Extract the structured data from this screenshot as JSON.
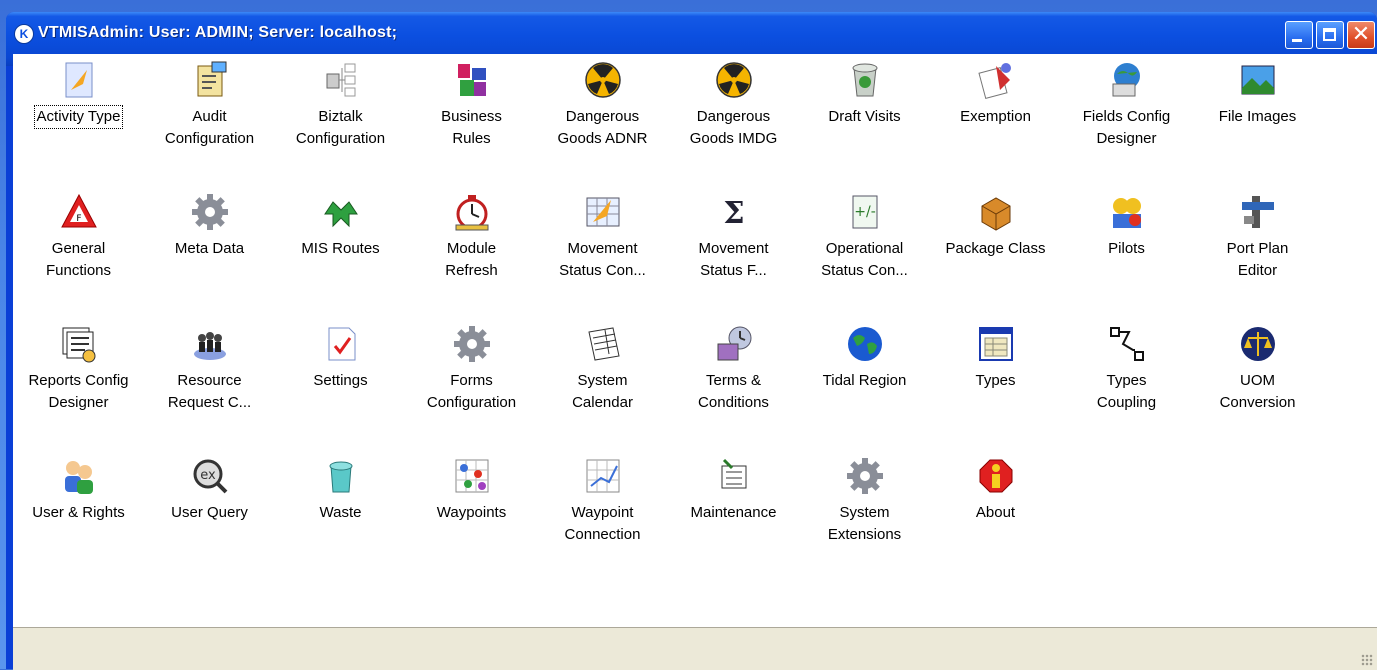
{
  "window": {
    "title": "VTMISAdmin: User: ADMIN; Server: localhost;",
    "app_icon_glyph": "K"
  },
  "items": [
    {
      "label": "Activity Type",
      "icon": "activity-type-icon"
    },
    {
      "label": "Audit\nConfiguration",
      "icon": "audit-configuration-icon"
    },
    {
      "label": "Biztalk\nConfiguration",
      "icon": "biztalk-configuration-icon"
    },
    {
      "label": "Business\nRules",
      "icon": "business-rules-icon"
    },
    {
      "label": "Dangerous\nGoods ADNR",
      "icon": "dangerous-goods-adnr-icon"
    },
    {
      "label": "Dangerous\nGoods IMDG",
      "icon": "dangerous-goods-imdg-icon"
    },
    {
      "label": "Draft Visits",
      "icon": "draft-visits-icon"
    },
    {
      "label": "Exemption",
      "icon": "exemption-icon"
    },
    {
      "label": "Fields Config\nDesigner",
      "icon": "fields-config-designer-icon"
    },
    {
      "label": "File Images",
      "icon": "file-images-icon"
    },
    {
      "label": "General\nFunctions",
      "icon": "general-functions-icon"
    },
    {
      "label": "Meta Data",
      "icon": "meta-data-icon"
    },
    {
      "label": "MIS Routes",
      "icon": "mis-routes-icon"
    },
    {
      "label": "Module\nRefresh",
      "icon": "module-refresh-icon"
    },
    {
      "label": "Movement\nStatus Con...",
      "icon": "movement-status-con-icon"
    },
    {
      "label": "Movement\nStatus F...",
      "icon": "movement-status-f-icon"
    },
    {
      "label": "Operational\nStatus Con...",
      "icon": "operational-status-con-icon"
    },
    {
      "label": "Package Class",
      "icon": "package-class-icon"
    },
    {
      "label": "Pilots",
      "icon": "pilots-icon"
    },
    {
      "label": "Port Plan\nEditor",
      "icon": "port-plan-editor-icon"
    },
    {
      "label": "Reports Config\nDesigner",
      "icon": "reports-config-designer-icon"
    },
    {
      "label": "Resource\nRequest C...",
      "icon": "resource-request-icon"
    },
    {
      "label": "Settings",
      "icon": "settings-icon"
    },
    {
      "label": "Forms\nConfiguration",
      "icon": "forms-configuration-icon"
    },
    {
      "label": "System\nCalendar",
      "icon": "system-calendar-icon"
    },
    {
      "label": "Terms &\nConditions",
      "icon": "terms-conditions-icon"
    },
    {
      "label": "Tidal Region",
      "icon": "tidal-region-icon"
    },
    {
      "label": "Types",
      "icon": "types-icon"
    },
    {
      "label": "Types\nCoupling",
      "icon": "types-coupling-icon"
    },
    {
      "label": "UOM\nConversion",
      "icon": "uom-conversion-icon"
    },
    {
      "label": "User & Rights",
      "icon": "user-rights-icon"
    },
    {
      "label": "User Query",
      "icon": "user-query-icon"
    },
    {
      "label": "Waste",
      "icon": "waste-icon"
    },
    {
      "label": "Waypoints",
      "icon": "waypoints-icon"
    },
    {
      "label": "Waypoint\nConnection",
      "icon": "waypoint-connection-icon"
    },
    {
      "label": "Maintenance",
      "icon": "maintenance-icon"
    },
    {
      "label": "System\nExtensions",
      "icon": "system-extensions-icon"
    },
    {
      "label": "About",
      "icon": "about-icon"
    }
  ],
  "selected_index": 0
}
